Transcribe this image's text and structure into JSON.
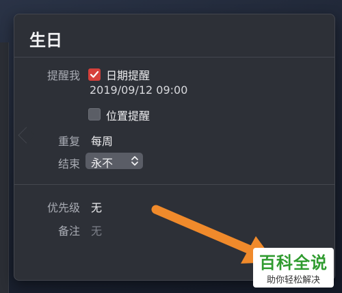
{
  "popup": {
    "title": "生日",
    "remind_label": "提醒我",
    "date_reminder": {
      "label": "日期提醒",
      "checked": true,
      "datetime": "2019/09/12  09:00"
    },
    "location_reminder": {
      "label": "位置提醒",
      "checked": false
    },
    "repeat": {
      "label": "重复",
      "value": "每周"
    },
    "end": {
      "label": "结束",
      "value": "永不"
    },
    "priority": {
      "label": "优先级",
      "value": "无"
    },
    "notes": {
      "label": "备注",
      "placeholder": "无"
    }
  },
  "watermark": {
    "title": "百科全说",
    "subtitle": "助你轻松解决"
  },
  "colors": {
    "checkbox_on": "#d6403b",
    "arrow": "#f08a2b",
    "brand_green": "#2f9b2f"
  }
}
